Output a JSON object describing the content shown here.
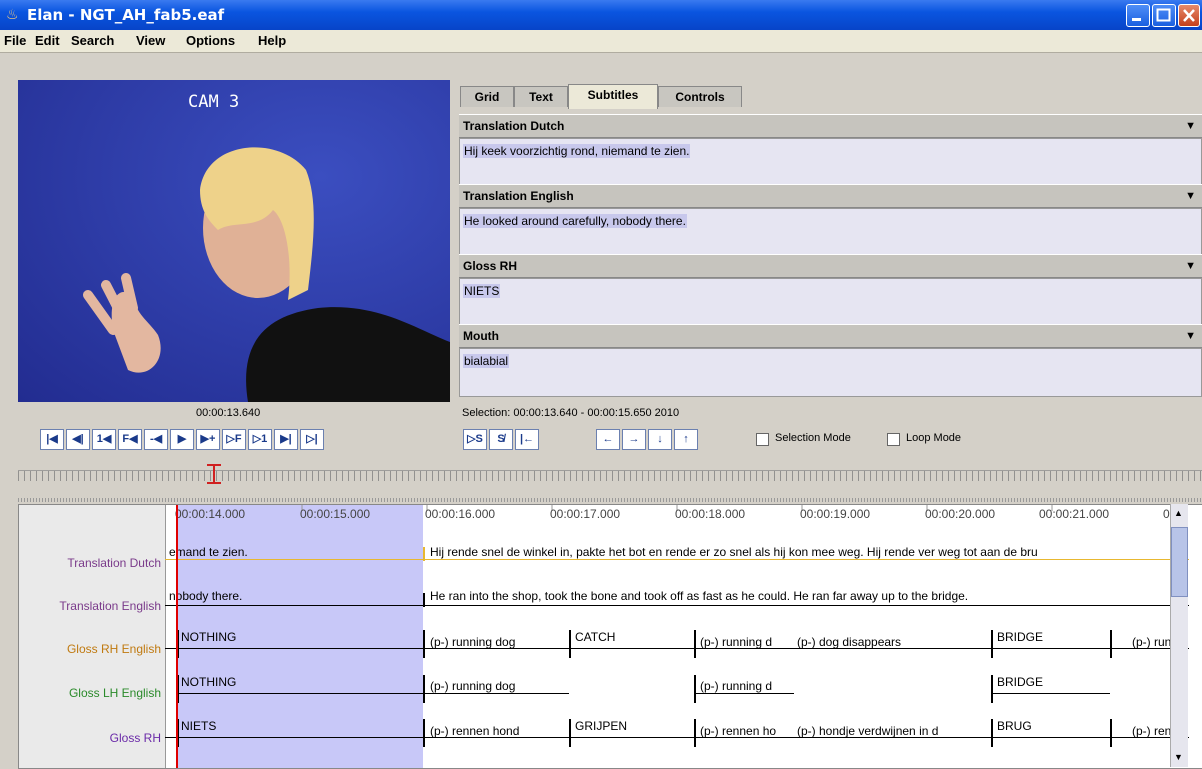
{
  "window": {
    "title": "Elan - NGT_AH_fab5.eaf"
  },
  "menu": [
    "File",
    "Edit",
    "Search",
    "View",
    "Options",
    "Help"
  ],
  "video": {
    "overlay_label": "CAM 3"
  },
  "tabs": [
    "Grid",
    "Text",
    "Subtitles",
    "Controls"
  ],
  "active_tab": "Subtitles",
  "subtitles": [
    {
      "tier": "Translation Dutch",
      "text": "Hij keek voorzichtig rond, niemand te zien."
    },
    {
      "tier": "Translation English",
      "text": "He looked around carefully, nobody there."
    },
    {
      "tier": "Gloss RH",
      "text": "NIETS"
    },
    {
      "tier": "Mouth",
      "text": "bialabial"
    }
  ],
  "player": {
    "current_time": "00:00:13.640",
    "selection_label": "Selection: 00:00:13.640 - 00:00:15.650  2010",
    "buttons": [
      "|◀",
      "◀|",
      "1◀",
      "F◀",
      "-◀",
      "▶",
      "▶+",
      "▷F",
      "▷1",
      "▶|",
      "▷|"
    ],
    "sel_buttons": [
      "▷S",
      "S̸",
      "|←"
    ],
    "arrow_buttons": [
      "←",
      "→",
      "↓",
      "↑"
    ],
    "selection_mode_label": "Selection Mode",
    "loop_mode_label": "Loop Mode"
  },
  "timeline": {
    "ticks": [
      "00:00:14.000",
      "00:00:15.000",
      "00:00:16.000",
      "00:00:17.000",
      "00:00:18.000",
      "00:00:19.000",
      "00:00:20.000",
      "00:00:21.000",
      "00:0"
    ],
    "tiers": [
      {
        "name": "Translation Dutch",
        "color": "#7a3a8a"
      },
      {
        "name": "Translation English",
        "color": "#7a3a8a"
      },
      {
        "name": "Gloss RH English",
        "color": "#c07a10"
      },
      {
        "name": "Gloss LH English",
        "color": "#2a8a2a"
      },
      {
        "name": "Gloss RH",
        "color": "#6a2aa8"
      }
    ],
    "row_dutch": [
      "emand te zien.",
      "Hij rende snel de winkel in, pakte het bot en rende er zo snel als hij kon mee weg. Hij rende ver weg tot aan de bru"
    ],
    "row_english": [
      "nobody there.",
      "He ran into the shop, took the bone and took off as fast as he could. He ran far away up to the bridge."
    ],
    "row_rh_en": [
      "NOTHING",
      "(p-) running dog",
      "CATCH",
      "(p-) running d",
      "(p-) dog disappears",
      "BRIDGE",
      "(p-) run"
    ],
    "row_lh_en": [
      "NOTHING",
      "(p-) running dog",
      "(p-) running d",
      "BRIDGE"
    ],
    "row_rh": [
      "NIETS",
      "(p-) rennen hond",
      "GRIJPEN",
      "(p-) rennen ho",
      "(p-) hondje verdwijnen in d",
      "BRUG",
      "(p-) ren"
    ]
  }
}
